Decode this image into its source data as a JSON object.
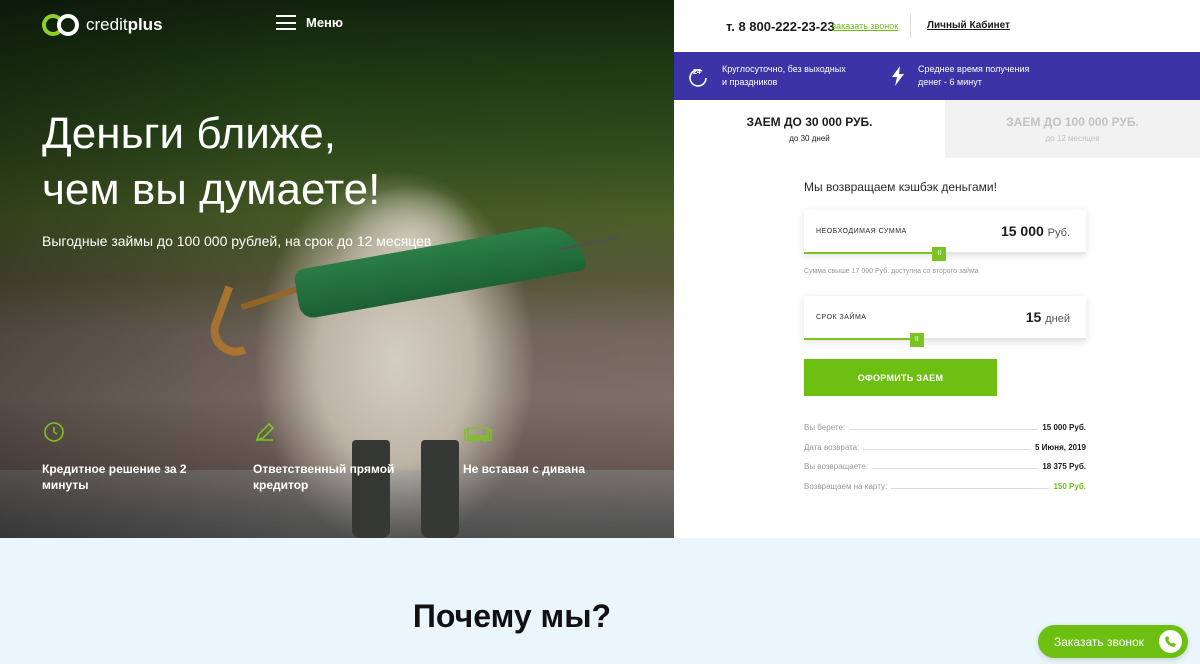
{
  "brand": {
    "name_light": "credit",
    "name_bold": "plus",
    "accent": "#6dbf12",
    "secondary": "#3b33a6"
  },
  "header": {
    "menu_label": "Меню"
  },
  "hero": {
    "title_line1": "Деньги ближе,",
    "title_line2": "чем вы думаете!",
    "subtitle": "Выгодные займы до 100 000 рублей, на срок до 12 месяцев",
    "features": [
      {
        "icon": "clock-icon",
        "label": "Кредитное решение за 2 минуты"
      },
      {
        "icon": "pencil-icon",
        "label": "Ответственный прямой кредитор"
      },
      {
        "icon": "sofa-icon",
        "label": "Не вставая с дивана"
      }
    ]
  },
  "topbar": {
    "phone": "т. 8 800-222-23-23",
    "callback_link": "заказать звонок",
    "cabinet_link": "Личный Кабинет"
  },
  "infobar": {
    "item1": {
      "icon": "24h-icon",
      "line1": "Круглосуточно, без выходных",
      "line2": "и праздников"
    },
    "item2": {
      "icon": "lightning-icon",
      "line1": "Среднее время получения",
      "line2": "денег - 6 минут"
    }
  },
  "tabs": [
    {
      "title": "ЗАЕМ ДО 30 000 РУБ.",
      "sub": "до 30 дней",
      "active": true
    },
    {
      "title": "ЗАЕМ ДО 100 000 РУБ.",
      "sub": "до 12 месяцев",
      "active": false
    }
  ],
  "form": {
    "heading": "Мы возвращаем кэшбэк деньгами!",
    "amount": {
      "label": "НЕОБХОДИМАЯ СУММА",
      "value": "15 000",
      "unit": "Руб.",
      "slider_fraction": 0.48
    },
    "hint": "Сумма свыше 17 000 Руб. доступна со второго займа",
    "term": {
      "label": "СРОК ЗАЙМА",
      "value": "15",
      "unit": "дней",
      "slider_fraction": 0.4
    },
    "thumb_glyph": "II",
    "submit_label": "ОФОРМИТЬ ЗАЕМ"
  },
  "summary": [
    {
      "label": "Вы берете:",
      "value": "15 000 Руб."
    },
    {
      "label": "Дата возврата:",
      "value": "5 Июня, 2019"
    },
    {
      "label": "Вы возвращаете:",
      "value": "18 375 Руб."
    },
    {
      "label": "Возвращаем на карту:",
      "value": "150 Руб.",
      "highlight": true
    }
  ],
  "why": {
    "title": "Почему мы?"
  },
  "callback_button": {
    "label": "Заказать звонок",
    "icon": "phone-icon"
  }
}
